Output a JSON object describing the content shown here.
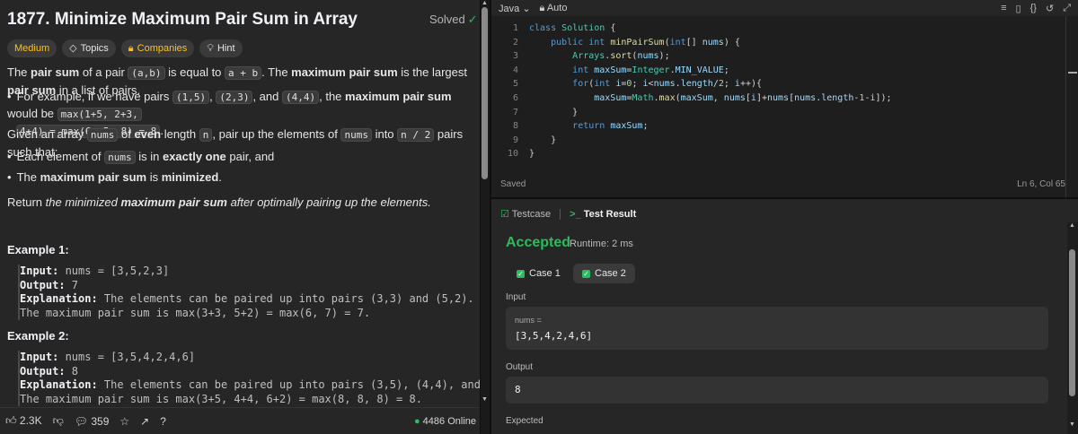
{
  "problem": {
    "title": "1877. Minimize Maximum Pair Sum in Array",
    "solved": "Solved",
    "tags": {
      "difficulty": "Medium",
      "topics": "Topics",
      "companies": "Companies",
      "hint": "Hint"
    },
    "p1": [
      "The ",
      "pair sum",
      " of a pair ",
      "(a,b)",
      " is equal to ",
      "a + b",
      ". The ",
      "maximum pair sum",
      " is the largest ",
      "pair sum",
      " in a list of pairs."
    ],
    "b1": [
      "For example, if we have pairs ",
      "(1,5)",
      ", ",
      "(2,3)",
      ", and ",
      "(4,4)",
      ", the ",
      "maximum pair sum",
      " would be ",
      "max(1+5, 2+3,",
      "4+4) = max(6, 5, 8) = 8",
      "."
    ],
    "p2": [
      "Given an array ",
      "nums",
      " of ",
      "even",
      " length ",
      "n",
      ", pair up the elements of ",
      "nums",
      " into ",
      "n / 2",
      " pairs such that:"
    ],
    "b2": [
      "Each element of ",
      "nums",
      " is in ",
      "exactly one",
      " pair, and"
    ],
    "b3": [
      "The ",
      "maximum pair sum",
      " is ",
      "minimized",
      "."
    ],
    "p3": [
      "Return ",
      "the minimized ",
      "maximum pair sum",
      " after optimally pairing up the elements."
    ],
    "ex1": {
      "label": "Example 1:",
      "input_k": "Input:",
      "input_v": " nums = [3,5,2,3]",
      "output_k": "Output:",
      "output_v": " 7",
      "expl_k": "Explanation:",
      "expl_v": " The elements can be paired up into pairs (3,3) and (5,2).",
      "expl_2": "The maximum pair sum is max(3+3, 5+2) = max(6, 7) = 7."
    },
    "ex2": {
      "label": "Example 2:",
      "input_k": "Input:",
      "input_v": " nums = [3,5,4,2,4,6]",
      "output_k": "Output:",
      "output_v": " 8",
      "expl_k": "Explanation:",
      "expl_v": " The elements can be paired up into pairs (3,5), (4,4), and (6,2).",
      "expl_2": "The maximum pair sum is max(3+5, 4+4, 6+2) = max(8, 8, 8) = 8."
    },
    "footer": {
      "likes": "2.3K",
      "comments": "359",
      "online": "4486 Online"
    }
  },
  "editor": {
    "language": "Java",
    "mode": "Auto",
    "line_numbers": [
      "1",
      "2",
      "3",
      "4",
      "5",
      "6",
      "7",
      "8",
      "9",
      "10"
    ],
    "saved": "Saved",
    "cursor": "Ln 6, Col 65"
  },
  "result": {
    "tab_testcase": "Testcase",
    "tab_result": "Test Result",
    "status": "Accepted",
    "runtime": "Runtime: 2 ms",
    "case1": "Case 1",
    "case2": "Case 2",
    "input_label": "Input",
    "input_var": "nums =",
    "input_val": "[3,5,4,2,4,6]",
    "output_label": "Output",
    "output_val": "8",
    "expected_label": "Expected"
  },
  "colors": {
    "accent_green": "#2cbb5d",
    "difficulty": "#ffc01e"
  }
}
